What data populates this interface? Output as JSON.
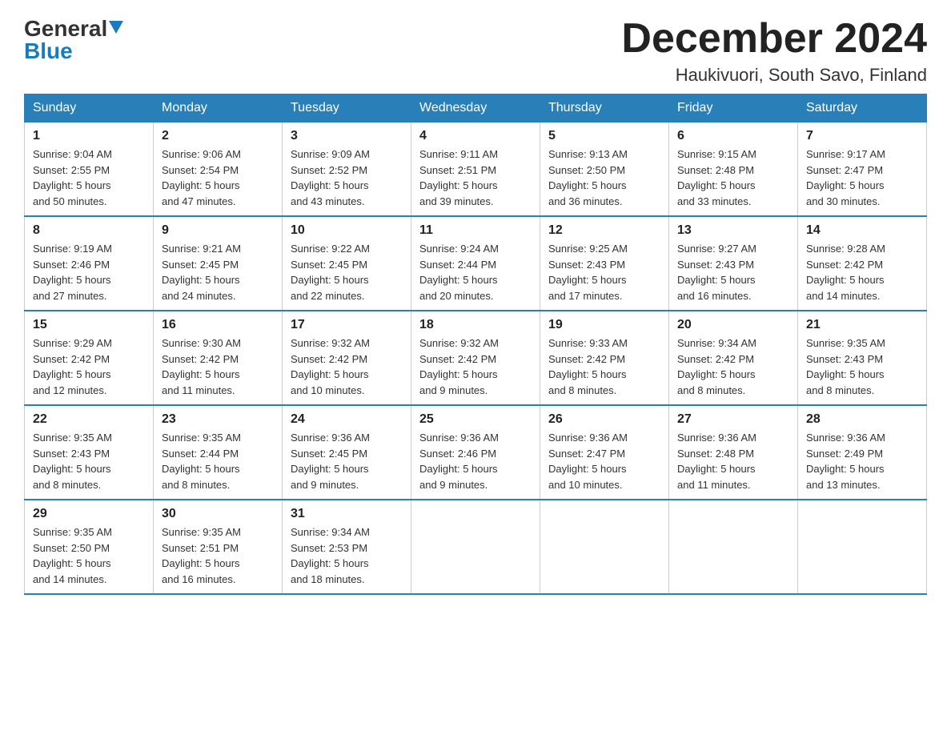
{
  "header": {
    "logo_main": "General",
    "logo_blue": "Blue",
    "month_title": "December 2024",
    "location": "Haukivuori, South Savo, Finland"
  },
  "weekdays": [
    "Sunday",
    "Monday",
    "Tuesday",
    "Wednesday",
    "Thursday",
    "Friday",
    "Saturday"
  ],
  "weeks": [
    [
      {
        "day": "1",
        "sunrise": "9:04 AM",
        "sunset": "2:55 PM",
        "daylight": "5 hours and 50 minutes."
      },
      {
        "day": "2",
        "sunrise": "9:06 AM",
        "sunset": "2:54 PM",
        "daylight": "5 hours and 47 minutes."
      },
      {
        "day": "3",
        "sunrise": "9:09 AM",
        "sunset": "2:52 PM",
        "daylight": "5 hours and 43 minutes."
      },
      {
        "day": "4",
        "sunrise": "9:11 AM",
        "sunset": "2:51 PM",
        "daylight": "5 hours and 39 minutes."
      },
      {
        "day": "5",
        "sunrise": "9:13 AM",
        "sunset": "2:50 PM",
        "daylight": "5 hours and 36 minutes."
      },
      {
        "day": "6",
        "sunrise": "9:15 AM",
        "sunset": "2:48 PM",
        "daylight": "5 hours and 33 minutes."
      },
      {
        "day": "7",
        "sunrise": "9:17 AM",
        "sunset": "2:47 PM",
        "daylight": "5 hours and 30 minutes."
      }
    ],
    [
      {
        "day": "8",
        "sunrise": "9:19 AM",
        "sunset": "2:46 PM",
        "daylight": "5 hours and 27 minutes."
      },
      {
        "day": "9",
        "sunrise": "9:21 AM",
        "sunset": "2:45 PM",
        "daylight": "5 hours and 24 minutes."
      },
      {
        "day": "10",
        "sunrise": "9:22 AM",
        "sunset": "2:45 PM",
        "daylight": "5 hours and 22 minutes."
      },
      {
        "day": "11",
        "sunrise": "9:24 AM",
        "sunset": "2:44 PM",
        "daylight": "5 hours and 20 minutes."
      },
      {
        "day": "12",
        "sunrise": "9:25 AM",
        "sunset": "2:43 PM",
        "daylight": "5 hours and 17 minutes."
      },
      {
        "day": "13",
        "sunrise": "9:27 AM",
        "sunset": "2:43 PM",
        "daylight": "5 hours and 16 minutes."
      },
      {
        "day": "14",
        "sunrise": "9:28 AM",
        "sunset": "2:42 PM",
        "daylight": "5 hours and 14 minutes."
      }
    ],
    [
      {
        "day": "15",
        "sunrise": "9:29 AM",
        "sunset": "2:42 PM",
        "daylight": "5 hours and 12 minutes."
      },
      {
        "day": "16",
        "sunrise": "9:30 AM",
        "sunset": "2:42 PM",
        "daylight": "5 hours and 11 minutes."
      },
      {
        "day": "17",
        "sunrise": "9:32 AM",
        "sunset": "2:42 PM",
        "daylight": "5 hours and 10 minutes."
      },
      {
        "day": "18",
        "sunrise": "9:32 AM",
        "sunset": "2:42 PM",
        "daylight": "5 hours and 9 minutes."
      },
      {
        "day": "19",
        "sunrise": "9:33 AM",
        "sunset": "2:42 PM",
        "daylight": "5 hours and 8 minutes."
      },
      {
        "day": "20",
        "sunrise": "9:34 AM",
        "sunset": "2:42 PM",
        "daylight": "5 hours and 8 minutes."
      },
      {
        "day": "21",
        "sunrise": "9:35 AM",
        "sunset": "2:43 PM",
        "daylight": "5 hours and 8 minutes."
      }
    ],
    [
      {
        "day": "22",
        "sunrise": "9:35 AM",
        "sunset": "2:43 PM",
        "daylight": "5 hours and 8 minutes."
      },
      {
        "day": "23",
        "sunrise": "9:35 AM",
        "sunset": "2:44 PM",
        "daylight": "5 hours and 8 minutes."
      },
      {
        "day": "24",
        "sunrise": "9:36 AM",
        "sunset": "2:45 PM",
        "daylight": "5 hours and 9 minutes."
      },
      {
        "day": "25",
        "sunrise": "9:36 AM",
        "sunset": "2:46 PM",
        "daylight": "5 hours and 9 minutes."
      },
      {
        "day": "26",
        "sunrise": "9:36 AM",
        "sunset": "2:47 PM",
        "daylight": "5 hours and 10 minutes."
      },
      {
        "day": "27",
        "sunrise": "9:36 AM",
        "sunset": "2:48 PM",
        "daylight": "5 hours and 11 minutes."
      },
      {
        "day": "28",
        "sunrise": "9:36 AM",
        "sunset": "2:49 PM",
        "daylight": "5 hours and 13 minutes."
      }
    ],
    [
      {
        "day": "29",
        "sunrise": "9:35 AM",
        "sunset": "2:50 PM",
        "daylight": "5 hours and 14 minutes."
      },
      {
        "day": "30",
        "sunrise": "9:35 AM",
        "sunset": "2:51 PM",
        "daylight": "5 hours and 16 minutes."
      },
      {
        "day": "31",
        "sunrise": "9:34 AM",
        "sunset": "2:53 PM",
        "daylight": "5 hours and 18 minutes."
      },
      null,
      null,
      null,
      null
    ]
  ]
}
